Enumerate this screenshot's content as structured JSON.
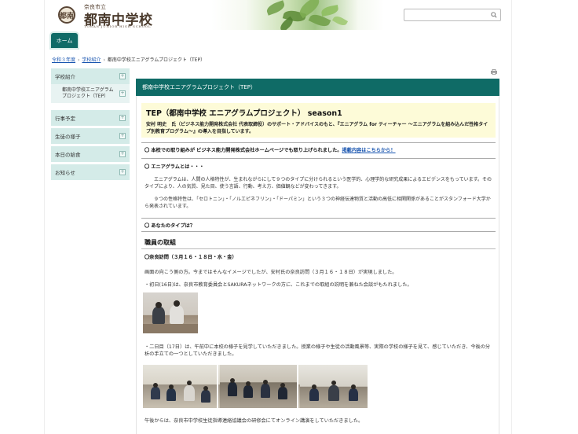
{
  "header": {
    "logo_emblem": "都南",
    "city": "奈良市立",
    "school_name": "都南中学校",
    "school_name_en": "TONAN JUNIOR HIGH SCHOOL",
    "search_placeholder": ""
  },
  "nav": {
    "home_label": "ホーム"
  },
  "breadcrumb": {
    "items": [
      "令和３年度",
      "学校紹介",
      "都南中学校エニアグラムプロジェクト（TEP）"
    ],
    "separator": "›"
  },
  "sidebar": {
    "items": [
      {
        "label": "学校紹介"
      },
      {
        "label": "都南中学校エニアグラムプロジェクト（TEP）",
        "sub": true
      },
      {
        "label": "行事予定"
      },
      {
        "label": "生徒の様子"
      },
      {
        "label": "本日の給食"
      },
      {
        "label": "お知らせ"
      }
    ]
  },
  "main": {
    "header_title": "都南中学校エニアグラムプロジェクト（TEP）",
    "tep_title": "TEP（都南中学校 エニアグラムプロジェクト） season1",
    "tep_text": "安村 明史　氏（ビジネス能力開発株式会社 代表取締役）のサポート・アドバイスのもと、『エニアグラム for ティーチャー ～エニアグラムを組み込んだ性格タイプ別教育プログラム～』の導入を目指しています。",
    "sec1_text": "〇 本校での取り組みが ビジネス能力開発株式会社ホームページでも取り上げられました。",
    "sec1_link": "掲載内容はこちらから！",
    "sec2_title": "〇 エニアグラムとは・・・",
    "para1": "エニアグラムは、人間の人格特性が、生まれながらにして９つのタイプに分けられるという医学的、心理学的な研究成果によるエビデンスをもっています。そのタイプにより、人の気質、見た目、使う言語、行動、考え方、価値観などが変わってきます。",
    "para2": "９つの性格特性は、「セロトニン」・「ノルエピネフリン」・「ドーパミン」という３つの神経伝達物質と活動の高低に相関関係があることがスタンフォード大学から発表されています。",
    "sec3_title": "〇 あなたのタイプは？",
    "staff_heading": "職員の取組",
    "visit_heading": "〇奈良訪問（３月１６・１８日・水・金）",
    "visit_text1": "画面の向こう側の方。今まではそんなイメージでしたが、安村氏の奈良訪問（３月１６・１８日）が実現しました。",
    "visit_text2": "・初日(16日)は、奈良市教育委員会とSAKURAネットワークの方に、これまでの取組の説明を兼ねた会談がもたれました。",
    "visit_text3": "・二日目（17日）は、午前中に本校の様子を見学していただきました。授業の様子や生徒の活動風景等、実際の学校の様子を見て、感じていただき、今後の分析の手立ての一つとしていただきました。",
    "visit_text4": "午後からは、奈良市中学校生徒指導連絡協議会の研修会にてオンライン講演をしていただきました。"
  }
}
